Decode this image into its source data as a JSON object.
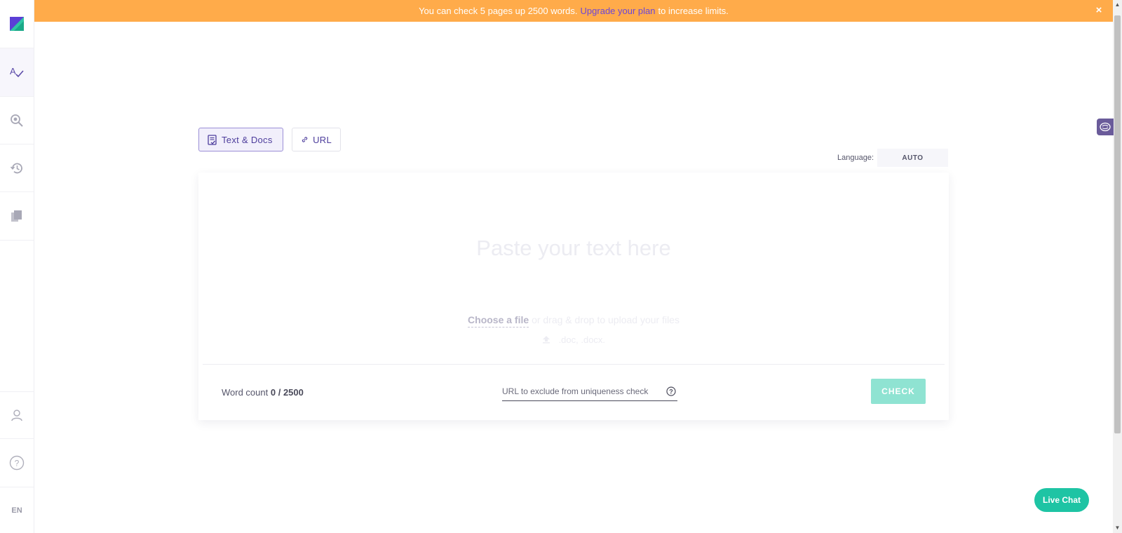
{
  "banner": {
    "text_before": "You can check 5 pages up 2500 words.",
    "link": "Upgrade your plan",
    "text_after": "to increase limits.",
    "close": "×"
  },
  "sidebar": {
    "language": "EN"
  },
  "tabs": [
    {
      "label": "Text & Docs",
      "active": true
    },
    {
      "label": "URL",
      "active": false
    }
  ],
  "language": {
    "label": "Language:",
    "value": "AUTO"
  },
  "editor": {
    "placeholder": "Paste your text here",
    "choose_file": "Choose a file",
    "upload_hint": "or drag & drop to upload your files",
    "file_types": ".doc, .docx."
  },
  "footer": {
    "word_count_label": "Word count",
    "word_count_value": "0 / 2500",
    "exclude_placeholder": "URL to exclude from uniqueness check",
    "check_label": "CHECK"
  },
  "live_chat": "Live Chat",
  "colors": {
    "banner": "#ffab4a",
    "brand_purple": "#6b45d8",
    "check_button": "#8fe3d2",
    "live_chat": "#1ec4a4"
  }
}
